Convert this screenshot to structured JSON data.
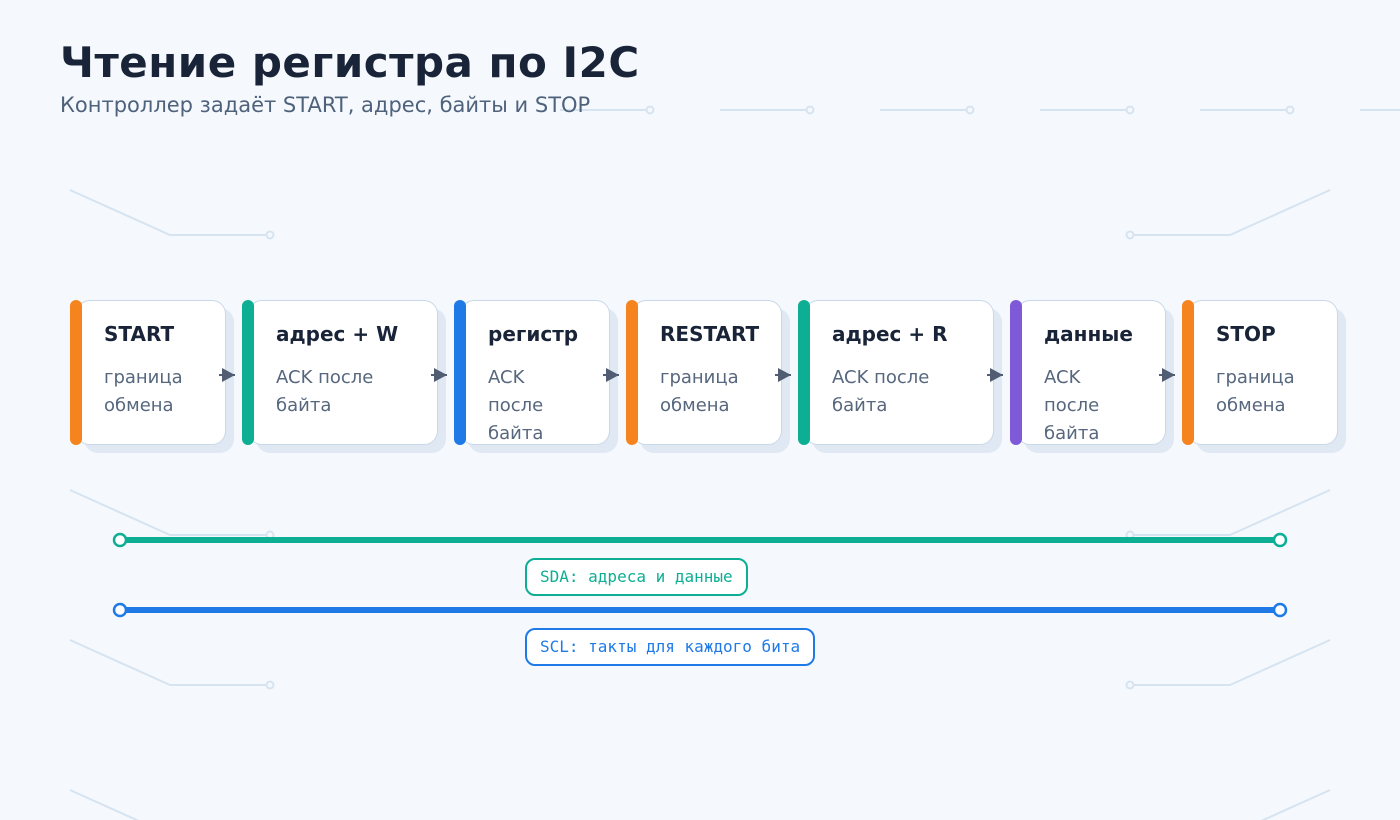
{
  "title": "Чтение регистра по I2C",
  "subtitle": "Контроллер задаёт START, адрес, байты и STOP",
  "steps": [
    {
      "label": "START",
      "desc": "граница обмена",
      "color": "#f5841f"
    },
    {
      "label": "адрес + W",
      "desc": "ACK после байта",
      "color": "#0eae94"
    },
    {
      "label": "регистр",
      "desc": "ACK после байта",
      "color": "#1f7ae8"
    },
    {
      "label": "RESTART",
      "desc": "граница обмена",
      "color": "#f5841f"
    },
    {
      "label": "адрес + R",
      "desc": "ACK после байта",
      "color": "#0eae94"
    },
    {
      "label": "данные",
      "desc": "ACK после байта",
      "color": "#7e5ad9"
    },
    {
      "label": "STOP",
      "desc": "граница обмена",
      "color": "#f5841f"
    }
  ],
  "buses": [
    {
      "label": "SDA: адреса и данные",
      "color": "#0eae94"
    },
    {
      "label": "SCL: такты для каждого бита",
      "color": "#1f7ae8"
    }
  ]
}
